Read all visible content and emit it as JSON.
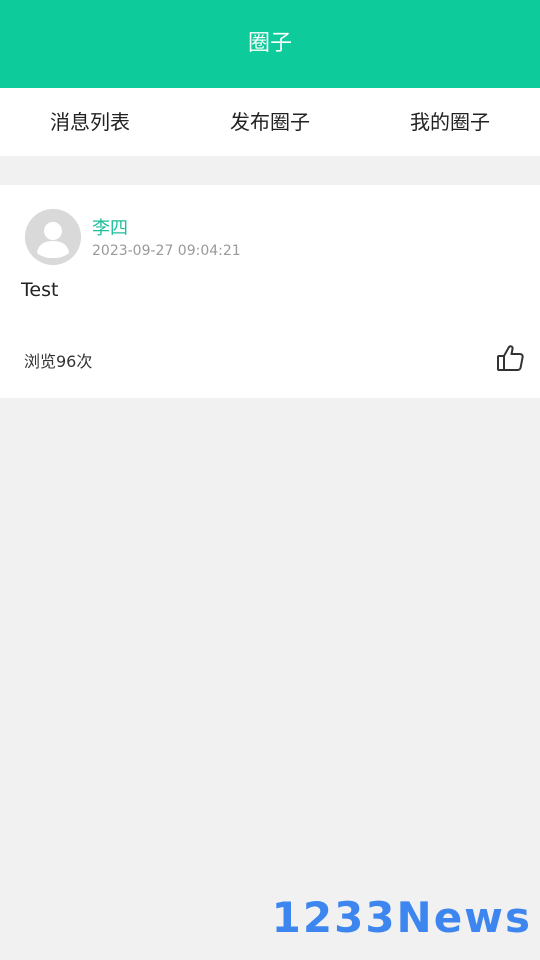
{
  "header": {
    "title": "圈子",
    "color": "#0ecb9b"
  },
  "tabs": [
    {
      "label": "消息列表"
    },
    {
      "label": "发布圈子"
    },
    {
      "label": "我的圈子"
    }
  ],
  "post": {
    "author": "李四",
    "time": "2023-09-27 09:04:21",
    "content": "Test",
    "views": "浏览96次",
    "avatar_icon": "user-avatar-icon",
    "like_icon": "thumbs-up-icon"
  },
  "watermark": "1233News",
  "colors": {
    "accent": "#0ecb9b",
    "author_name": "#1dbf9a",
    "background": "#f1f1f1"
  }
}
